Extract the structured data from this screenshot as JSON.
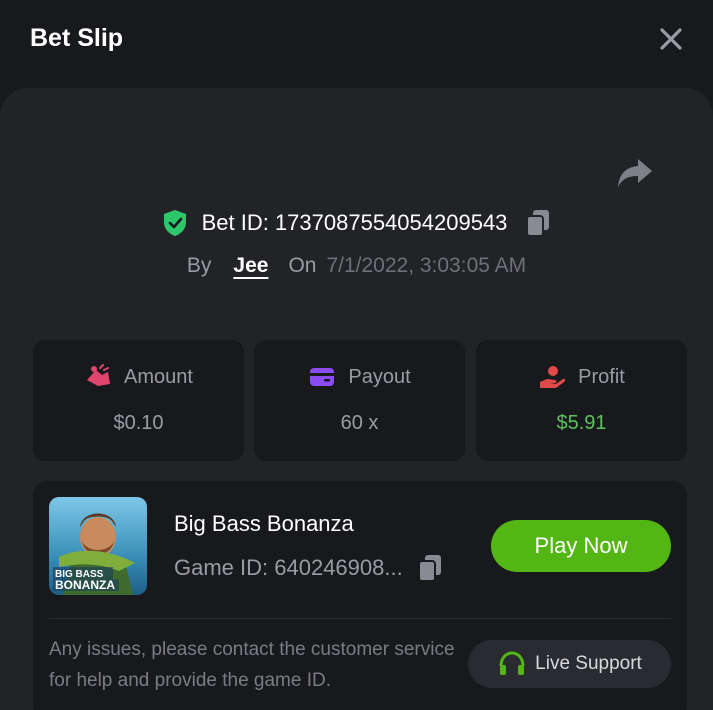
{
  "header": {
    "title": "Bet Slip"
  },
  "bet": {
    "id_text": "Bet ID: 1737087554054209543",
    "by_label": "By",
    "user": "Jee",
    "on_label": "On",
    "date": "7/1/2022, 3:03:05 AM"
  },
  "stats": [
    {
      "label": "Amount",
      "value": "$0.10",
      "icon": "amount-icon",
      "color": "#e0456e"
    },
    {
      "label": "Payout",
      "value": "60 x",
      "icon": "card-icon",
      "color": "#8b4cf0"
    },
    {
      "label": "Profit",
      "value": "$5.91",
      "icon": "hand-coin-icon",
      "color": "#e24a4a"
    }
  ],
  "game": {
    "name": "Big Bass Bonanza",
    "id_text": "Game ID: 640246908...",
    "play_label": "Play Now",
    "thumb_text_1": "BIG BASS",
    "thumb_text_2": "BONANZA"
  },
  "support": {
    "text": "Any issues, please contact the customer service for help and provide the game ID.",
    "button_label": "Live Support"
  },
  "colors": {
    "background": "#18191d",
    "panel": "#222327",
    "accent_green": "#53b614",
    "profit_green": "#5ec25a",
    "shield_green": "#2ec66a"
  }
}
